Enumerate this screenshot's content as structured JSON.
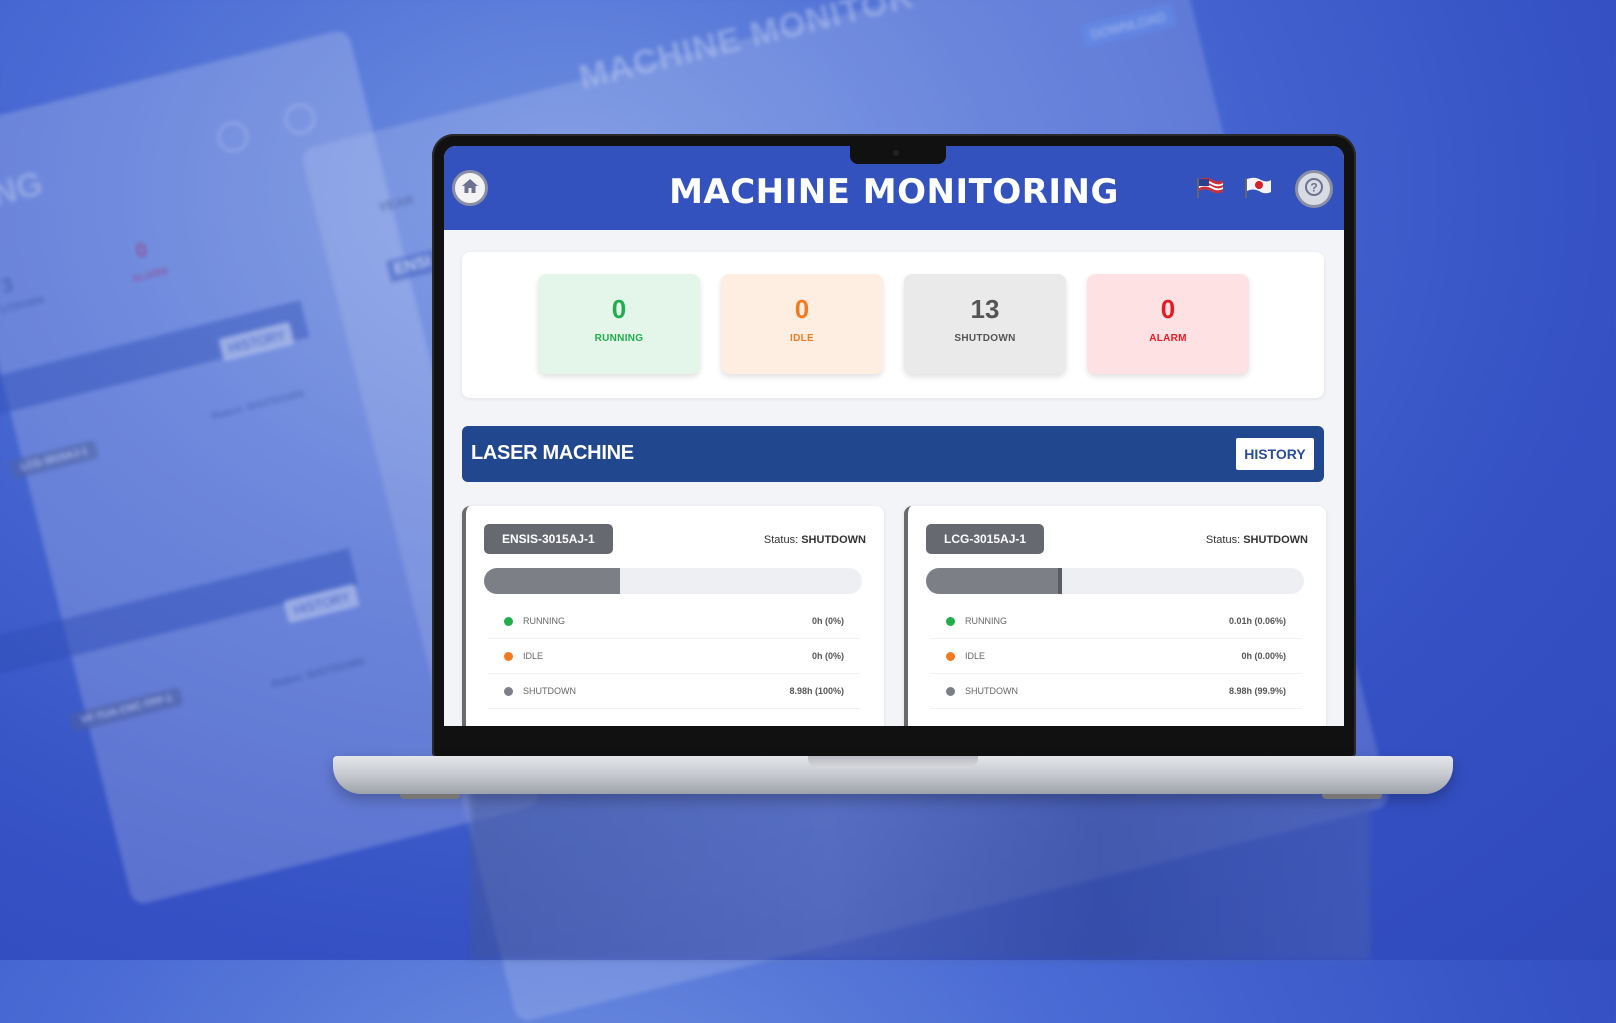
{
  "app": {
    "title": "MACHINE MONITORING"
  },
  "header": {
    "home_icon": "home-icon",
    "flag_left_icon": "us-flag-icon",
    "flag_right_icon": "japan-flag-icon",
    "help_icon": "question-icon"
  },
  "stats": [
    {
      "value": "0",
      "label": "RUNNING",
      "color": "#1fae4b",
      "bg": "#e4f6ea"
    },
    {
      "value": "0",
      "label": "IDLE",
      "color": "#f47a1f",
      "bg": "#fdeee1"
    },
    {
      "value": "13",
      "label": "SHUTDOWN",
      "color": "#555555",
      "bg": "#eaeaea"
    },
    {
      "value": "0",
      "label": "ALARM",
      "color": "#e41b23",
      "bg": "#fde1e3"
    }
  ],
  "section": {
    "title": "LASER MACHINE",
    "history_label": "HISTORY"
  },
  "machines": [
    {
      "name": "ENSIS-3015AJ-1",
      "status_label": "Status:",
      "status_value": "SHUTDOWN",
      "progress": 0.36,
      "rows": [
        {
          "label": "RUNNING",
          "value": "0h (0%)",
          "color": "#1fae4b"
        },
        {
          "label": "IDLE",
          "value": "0h (0%)",
          "color": "#f47a1f"
        },
        {
          "label": "SHUTDOWN",
          "value": "8.98h (100%)",
          "color": "#7c7f85"
        }
      ]
    },
    {
      "name": "LCG-3015AJ-1",
      "status_label": "Status:",
      "status_value": "SHUTDOWN",
      "progress": 0.35,
      "rows": [
        {
          "label": "RUNNING",
          "value": "0.01h (0.06%)",
          "color": "#1fae4b"
        },
        {
          "label": "IDLE",
          "value": "0h (0.00%)",
          "color": "#f47a1f"
        },
        {
          "label": "SHUTDOWN",
          "value": "8.98h (99.9%)",
          "color": "#7c7f85"
        }
      ]
    }
  ],
  "background": {
    "title": "MACHINE MONITOR",
    "partial_title": "NG",
    "history_label": "HISTORY",
    "status_text": "Status: SHUTDOWN",
    "year_label": "YEAR",
    "alarm_value": "0",
    "alarm_label": "ALARM",
    "shutdown_value": "3",
    "shutdown_label": "UTDOWN",
    "machine_name": "LCG-3015AJ-1",
    "machine_name_2": "VF-TUA-CNC-TPP-1",
    "ensis_partial": "ENSI",
    "download_label": "DOWNLOAD"
  }
}
